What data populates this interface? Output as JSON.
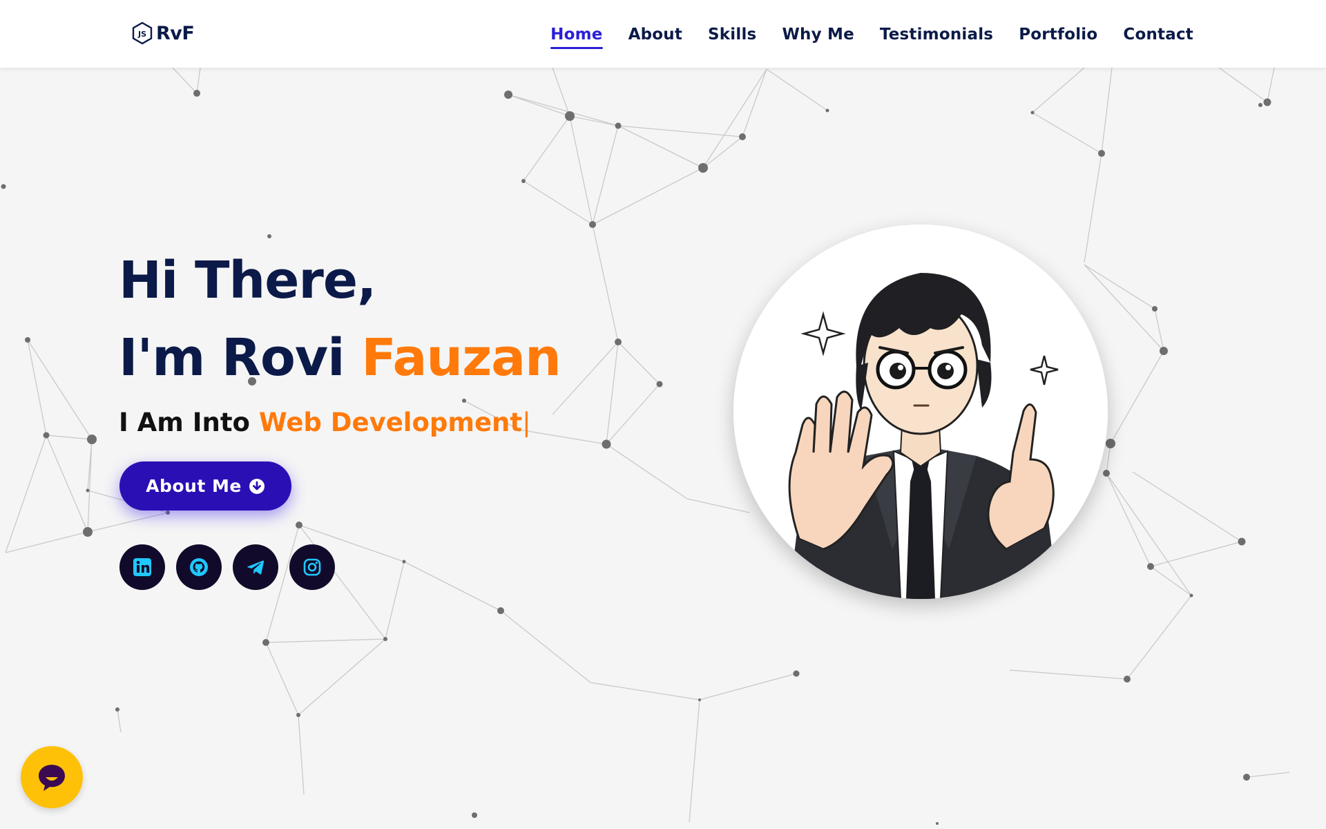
{
  "brand": {
    "logo_text": "RvF",
    "logo_icon": "js-hexagon-icon"
  },
  "nav": {
    "items": [
      {
        "label": "Home",
        "active": true
      },
      {
        "label": "About",
        "active": false
      },
      {
        "label": "Skills",
        "active": false
      },
      {
        "label": "Why Me",
        "active": false
      },
      {
        "label": "Testimonials",
        "active": false
      },
      {
        "label": "Portfolio",
        "active": false
      },
      {
        "label": "Contact",
        "active": false
      }
    ]
  },
  "hero": {
    "greeting_line1": "Hi There,",
    "greeting_line2_prefix": "I'm Rovi ",
    "greeting_line2_accent": "Fauzan",
    "tagline_prefix": "I Am Into ",
    "tagline_typed": "Web Development",
    "cursor": "|",
    "button_label": "About Me",
    "button_icon": "arrow-circle-down-icon"
  },
  "socials": [
    {
      "name": "LinkedIn",
      "icon": "linkedin-icon"
    },
    {
      "name": "GitHub",
      "icon": "github-icon"
    },
    {
      "name": "Telegram",
      "icon": "telegram-icon"
    },
    {
      "name": "Instagram",
      "icon": "instagram-icon"
    }
  ],
  "avatar": {
    "description_icon": "anime-boy-waving-avatar"
  },
  "chat": {
    "icon": "chat-bubble-icon"
  },
  "colors": {
    "primary_navy": "#0b1a48",
    "accent_orange": "#ff7a0a",
    "button_indigo": "#2a0fb5",
    "nav_active": "#2a1fd6",
    "social_bg": "#120a2a",
    "social_icon": "#1fc8ff",
    "chat_yellow": "#ffc107",
    "background": "#f5f5f5"
  }
}
